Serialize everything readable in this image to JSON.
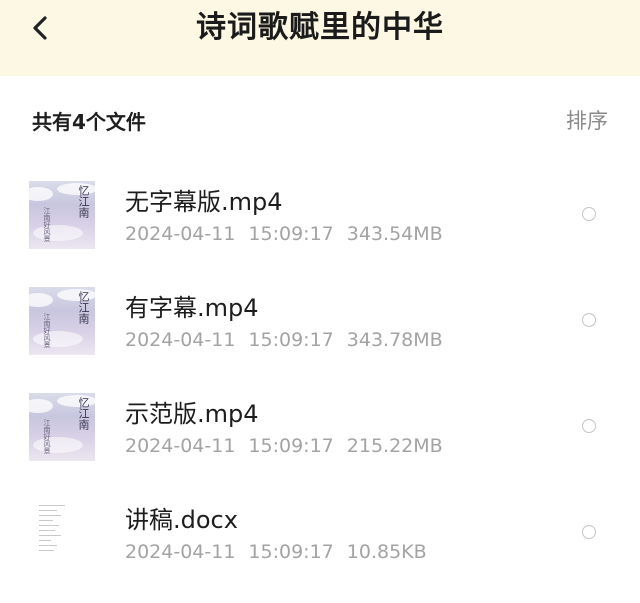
{
  "header": {
    "title": "诗词歌赋里的中华",
    "back_icon": "chevron-left-icon",
    "background": "#fdf8e4"
  },
  "toolbar": {
    "summary": "共有4个文件",
    "sort_label": "排序"
  },
  "files": [
    {
      "name": "无字幕版.mp4",
      "date": "2024-04-11",
      "time": "15:09:17",
      "size": "343.54MB",
      "type": "video"
    },
    {
      "name": "有字幕.mp4",
      "date": "2024-04-11",
      "time": "15:09:17",
      "size": "343.78MB",
      "type": "video"
    },
    {
      "name": "示范版.mp4",
      "date": "2024-04-11",
      "time": "15:09:17",
      "size": "215.22MB",
      "type": "video"
    },
    {
      "name": "讲稿.docx",
      "date": "2024-04-11",
      "time": "15:09:17",
      "size": "10.85KB",
      "type": "document"
    }
  ]
}
